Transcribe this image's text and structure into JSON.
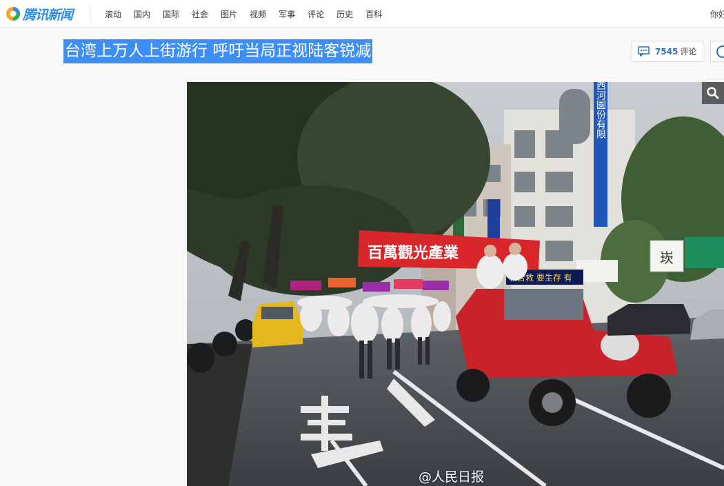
{
  "header": {
    "logo_text": "腾讯新闻",
    "nav": [
      "滚动",
      "国内",
      "国际",
      "社会",
      "图片",
      "视频",
      "军事",
      "评论",
      "历史",
      "百科"
    ],
    "greeting": "你好"
  },
  "article": {
    "title": "台湾上万人上街游行 呼吁当局正视陆客锐减",
    "comment_count": "7545",
    "comment_label": "评论"
  },
  "photo": {
    "watermark": "@人民日报",
    "banner_text": "百萬觀光產業",
    "led_text": "救台救 要生存 有",
    "building_sign": "西河園份有限",
    "shop_sign": "崁"
  },
  "colors": {
    "accent": "#2a8ee8",
    "title_highlight": "#3e8ff5",
    "banner_red": "#d9262b",
    "jeep_red": "#c9222a"
  },
  "icons": {
    "comment": "comment-bubble-icon",
    "play": "play-circle-icon",
    "zoom": "magnifier-icon"
  }
}
